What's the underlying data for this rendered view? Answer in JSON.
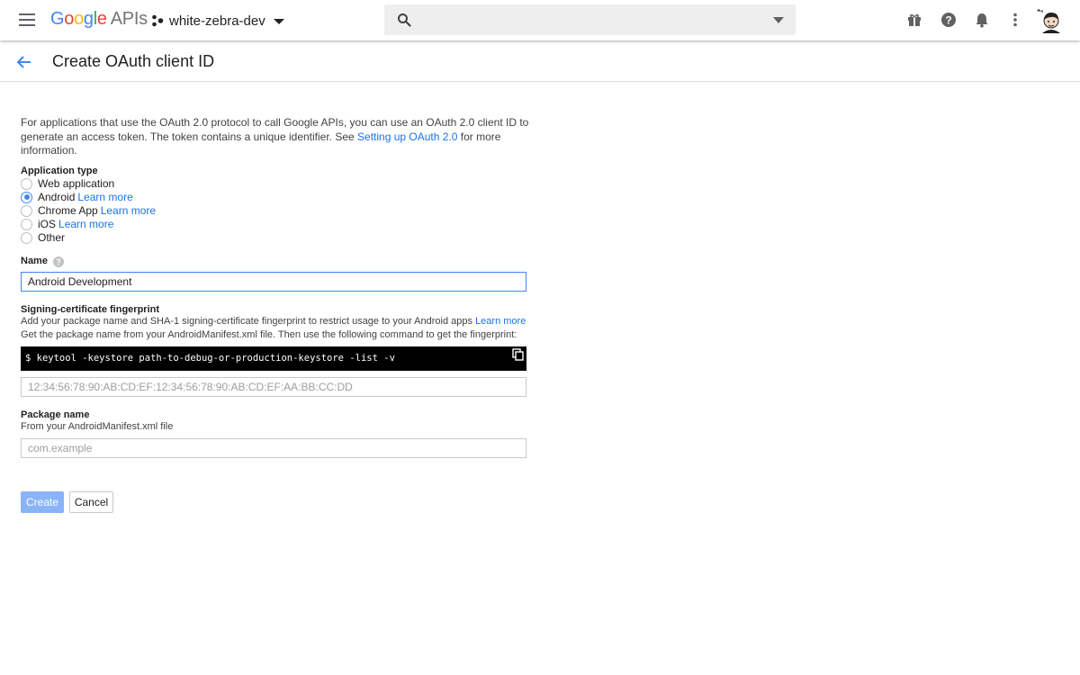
{
  "app": {
    "logo_parts": [
      "G",
      "o",
      "o",
      "g",
      "l",
      "e"
    ],
    "logo_suffix": "APIs",
    "project_name": "white-zebra-dev"
  },
  "topbar_icons": [
    "gift-icon",
    "help-icon",
    "notifications-icon",
    "more-vert-icon",
    "avatar"
  ],
  "page": {
    "title": "Create OAuth client ID"
  },
  "intro": {
    "text_before_link": "For applications that use the OAuth 2.0 protocol to call Google APIs, you can use an OAuth 2.0 client ID to generate an access token. The token contains a unique identifier. See ",
    "link_text": "Setting up OAuth 2.0",
    "text_after_link": " for more information."
  },
  "application_type": {
    "label": "Application type",
    "options": [
      {
        "label": "Web application",
        "link": "",
        "selected": false
      },
      {
        "label": "Android",
        "link": "Learn more",
        "selected": true
      },
      {
        "label": "Chrome App",
        "link": "Learn more",
        "selected": false
      },
      {
        "label": "iOS",
        "link": "Learn more",
        "selected": false
      },
      {
        "label": "Other",
        "link": "",
        "selected": false
      }
    ]
  },
  "name_field": {
    "label": "Name",
    "help_glyph": "?",
    "value": "Android Development"
  },
  "fingerprint": {
    "label": "Signing-certificate fingerprint",
    "desc1": "Add your package name and SHA-1 signing-certificate fingerprint to restrict usage to your Android apps ",
    "desc1_link": "Learn more",
    "desc2": "Get the package name from your AndroidManifest.xml file. Then use the following command to get the fingerprint:",
    "command": "$ keytool -keystore path-to-debug-or-production-keystore -list -v",
    "placeholder": "12:34:56:78:90:AB:CD:EF:12:34:56:78:90:AB:CD:EF:AA:BB:CC:DD"
  },
  "package_name": {
    "label": "Package name",
    "desc": "From your AndroidManifest.xml file",
    "placeholder": "com.example"
  },
  "actions": {
    "create_label": "Create",
    "cancel_label": "Cancel"
  },
  "colors": {
    "accent": "#4285f4",
    "link": "#1a73e8",
    "create_disabled": "#8ab4f8"
  }
}
